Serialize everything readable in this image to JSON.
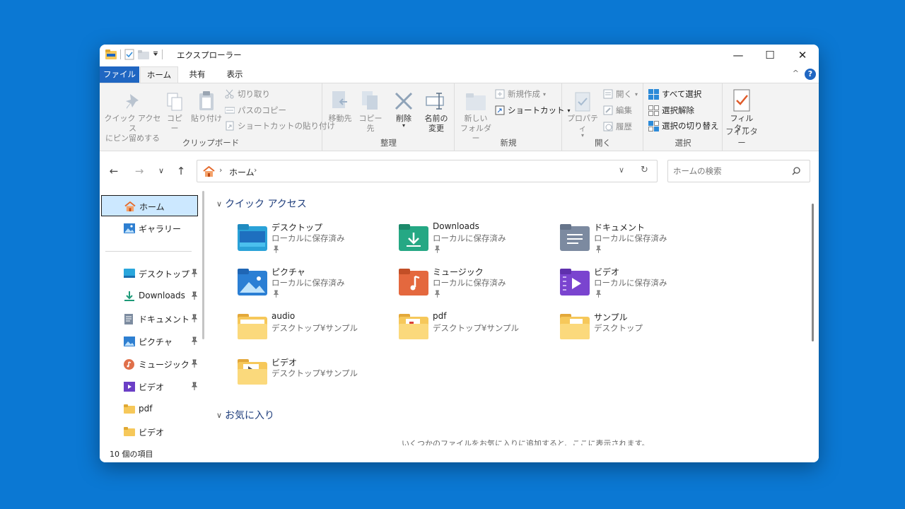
{
  "window": {
    "title": "エクスプローラー"
  },
  "title_controls": {
    "minimize": "—",
    "maximize": "☐",
    "close": "✕"
  },
  "tabs": {
    "file": "ファイル",
    "home": "ホーム",
    "share": "共有",
    "view": "表示",
    "collapse": "^",
    "help": "?"
  },
  "ribbon": {
    "clipboard": {
      "label": "クリップボード",
      "pin_line1": "クイック アクセス",
      "pin_line2": "にピン留めする",
      "copy": "コピー",
      "paste": "貼り付け",
      "cut": "切り取り",
      "copy_path": "パスのコピー",
      "paste_shortcut": "ショートカットの貼り付け"
    },
    "organize": {
      "label": "整理",
      "move_to": "移動先",
      "copy_to": "コピー先",
      "delete": "削除",
      "rename_line1": "名前の",
      "rename_line2": "変更"
    },
    "new": {
      "label": "新規",
      "new_folder_line1": "新しい",
      "new_folder_line2": "フォルダー",
      "new_item": "新規作成",
      "shortcut": "ショートカット"
    },
    "open": {
      "label": "開く",
      "properties": "プロパティ",
      "open": "開く",
      "edit": "編集",
      "history": "履歴"
    },
    "select": {
      "label": "選択",
      "select_all": "すべて選択",
      "select_none": "選択解除",
      "invert": "選択の切り替え"
    },
    "filter": {
      "label": "フィルター",
      "btn_line1": "フィル",
      "btn_line2": "ター"
    }
  },
  "address": {
    "crumb": "ホーム",
    "search_placeholder": "ホームの検索"
  },
  "nav": {
    "home": "ホーム",
    "gallery": "ギャラリー",
    "items": [
      "デスクトップ",
      "Downloads",
      "ドキュメント",
      "ピクチャ",
      "ミュージック",
      "ビデオ",
      "pdf",
      "ビデオ"
    ]
  },
  "content": {
    "quick_access_title": "クイック アクセス",
    "favorites_title": "お気に入り",
    "favorites_empty": "いくつかのファイルをお気に入りに追加すると、ここに表示されます。",
    "tiles": [
      {
        "name": "デスクトップ",
        "sub": "ローカルに保存済み",
        "icon": "desktop-folder-icon"
      },
      {
        "name": "Downloads",
        "sub": "ローカルに保存済み",
        "icon": "downloads-folder-icon"
      },
      {
        "name": "ドキュメント",
        "sub": "ローカルに保存済み",
        "icon": "documents-folder-icon"
      },
      {
        "name": "ピクチャ",
        "sub": "ローカルに保存済み",
        "icon": "pictures-folder-icon"
      },
      {
        "name": "ミュージック",
        "sub": "ローカルに保存済み",
        "icon": "music-folder-icon"
      },
      {
        "name": "ビデオ",
        "sub": "ローカルに保存済み",
        "icon": "videos-folder-icon"
      },
      {
        "name": "audio",
        "sub": "デスクトップ¥サンプル",
        "icon": "folder-icon"
      },
      {
        "name": "pdf",
        "sub": "デスクトップ¥サンプル",
        "icon": "folder-icon"
      },
      {
        "name": "サンプル",
        "sub": "デスクトップ",
        "icon": "folder-icon"
      },
      {
        "name": "ビデオ",
        "sub": "デスクトップ¥サンプル",
        "icon": "folder-icon"
      }
    ]
  },
  "status": {
    "count": "10 個の項目"
  },
  "colors": {
    "desktop_bg": "#0b78d3",
    "file_tab": "#1f66c2",
    "selection": "#cce8ff",
    "folder": "#f6c85a"
  }
}
